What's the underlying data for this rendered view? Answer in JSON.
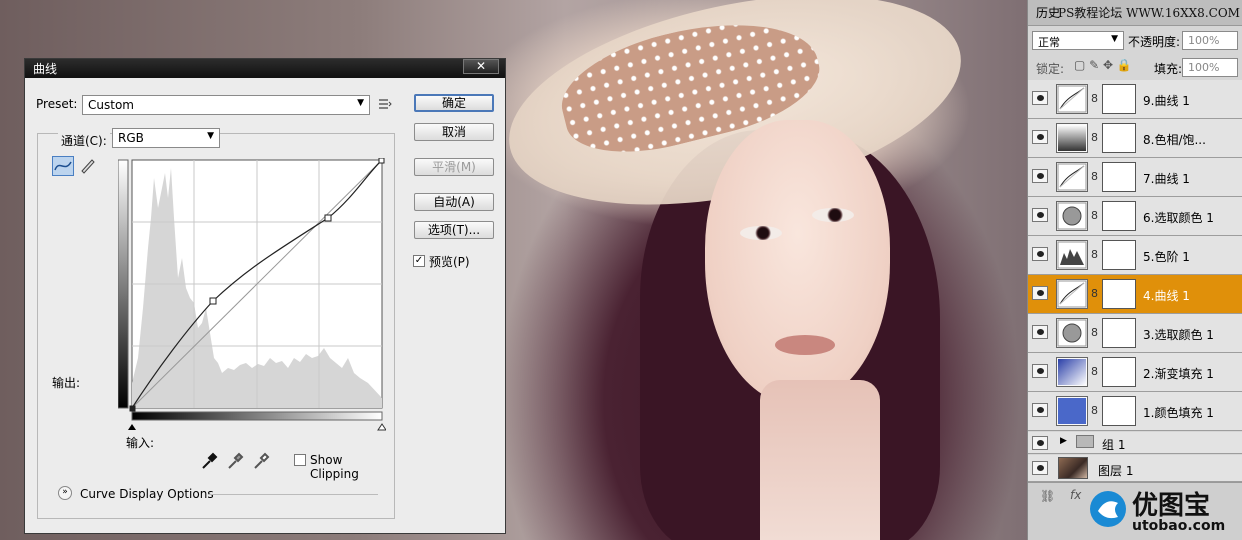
{
  "dialog": {
    "title": "曲线",
    "close": "✕",
    "preset_label": "Preset:",
    "preset_value": "Custom",
    "channel_label": "通道(C):",
    "channel_value": "RGB",
    "output_label": "输出:",
    "input_label": "输入:",
    "buttons": {
      "ok": "确定",
      "cancel": "取消",
      "smooth": "平滑(M)",
      "auto": "自动(A)",
      "options": "选项(T)..."
    },
    "preview_label": "预览(P)",
    "preview_checked": true,
    "show_clipping_label": "Show Clipping",
    "show_clipping_checked": false,
    "curve_display_label": "Curve Display Options"
  },
  "panel": {
    "tab_history": "历史",
    "watermark": "PS教程论坛 WWW.16XX8.COM",
    "blend_mode": "正常",
    "opacity_label": "不透明度:",
    "opacity_value": "100%",
    "lock_label": "锁定:",
    "fill_label": "填充:",
    "fill_value": "100%",
    "layers": [
      {
        "name": "9.曲线 1",
        "type": "curves"
      },
      {
        "name": "8.色相/饱...",
        "type": "huesat"
      },
      {
        "name": "7.曲线 1",
        "type": "curves"
      },
      {
        "name": "6.选取颜色 1",
        "type": "selective"
      },
      {
        "name": "5.色阶 1",
        "type": "levels"
      },
      {
        "name": "4.曲线 1",
        "type": "curves",
        "selected": true
      },
      {
        "name": "3.选取颜色 1",
        "type": "selective"
      },
      {
        "name": "2.渐变填充 1",
        "type": "gradient"
      },
      {
        "name": "1.颜色填充 1",
        "type": "color"
      }
    ],
    "group_name": "组 1",
    "base_layer_name": "图层 1"
  },
  "logo": {
    "text": "优图宝",
    "url_text": "utobao.com"
  },
  "colors": {
    "selected_layer": "#e0900a",
    "default_button_border": "#4b78b8",
    "logo_blue": "#1a8ad4"
  }
}
